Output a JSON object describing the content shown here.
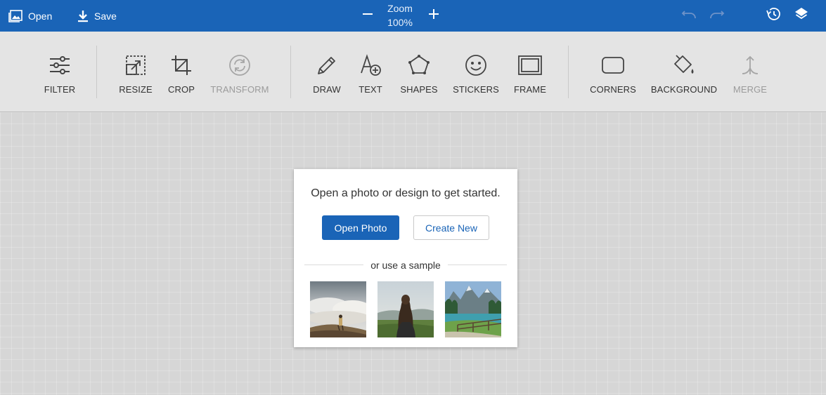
{
  "topbar": {
    "open_label": "Open",
    "save_label": "Save",
    "zoom_label": "Zoom",
    "zoom_value": "100%"
  },
  "toolbar": {
    "tools": [
      {
        "label": "FILTER",
        "icon": "sliders-icon",
        "enabled": true
      },
      {
        "label": "RESIZE",
        "icon": "resize-icon",
        "enabled": true
      },
      {
        "label": "CROP",
        "icon": "crop-icon",
        "enabled": true
      },
      {
        "label": "TRANSFORM",
        "icon": "rotate-icon",
        "enabled": false
      },
      {
        "label": "DRAW",
        "icon": "pencil-icon",
        "enabled": true
      },
      {
        "label": "TEXT",
        "icon": "text-add-icon",
        "enabled": true
      },
      {
        "label": "SHAPES",
        "icon": "pentagon-icon",
        "enabled": true
      },
      {
        "label": "STICKERS",
        "icon": "smiley-icon",
        "enabled": true
      },
      {
        "label": "FRAME",
        "icon": "frame-icon",
        "enabled": true
      },
      {
        "label": "CORNERS",
        "icon": "rounded-rect-icon",
        "enabled": true
      },
      {
        "label": "BACKGROUND",
        "icon": "paint-bucket-icon",
        "enabled": true
      },
      {
        "label": "MERGE",
        "icon": "merge-icon",
        "enabled": false
      }
    ]
  },
  "dialog": {
    "message": "Open a photo or design to get started.",
    "open_photo_label": "Open Photo",
    "create_new_label": "Create New",
    "sample_divider_text": "or use a sample",
    "samples": [
      "sample-clouds-hiker",
      "sample-woman-field",
      "sample-mountain-lake"
    ]
  },
  "colors": {
    "brand_blue": "#1a64b7",
    "toolbar_bg": "#e4e4e4",
    "canvas_bg": "#d6d6d6"
  }
}
